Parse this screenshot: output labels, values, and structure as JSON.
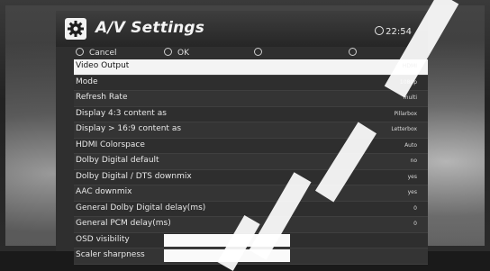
{
  "header": {
    "title": "A/V Settings",
    "time": "22:54"
  },
  "softkeys": [
    {
      "label": "Cancel"
    },
    {
      "label": "OK"
    },
    {
      "label": ""
    },
    {
      "label": ""
    }
  ],
  "settings": [
    {
      "label": "Video Output",
      "value": "HDMI",
      "selected": true
    },
    {
      "label": "Mode",
      "value": "1080p"
    },
    {
      "label": "Refresh Rate",
      "value": "multi"
    },
    {
      "label": "Display 4:3 content as",
      "value": "Pillarbox"
    },
    {
      "label": "Display > 16:9 content as",
      "value": "Letterbox"
    },
    {
      "label": "HDMI Colorspace",
      "value": "Auto"
    },
    {
      "label": "Dolby Digital default",
      "value": "no"
    },
    {
      "label": "Dolby Digital / DTS downmix",
      "value": "yes"
    },
    {
      "label": "AAC downmix",
      "value": "yes"
    },
    {
      "label": "General Dolby Digital delay(ms)",
      "value": "0"
    },
    {
      "label": "General PCM delay(ms)",
      "value": "0"
    },
    {
      "label": "OSD visibility",
      "value": "",
      "field": true
    },
    {
      "label": "Scaler sharpness",
      "value": "",
      "field": true
    }
  ],
  "icons": {
    "settings": "gear-icon",
    "clock": "clock-icon",
    "softkey": "softkey-dot-icon"
  },
  "colors": {
    "panel": "#2f2f2f",
    "selected_row": "#f4f4f4",
    "text": "#e8e8e8"
  }
}
